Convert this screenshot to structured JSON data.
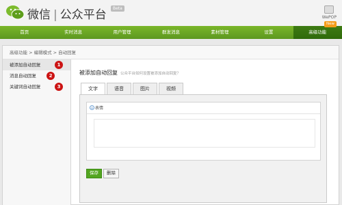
{
  "header": {
    "brand_name": "微信",
    "brand_separator": "|",
    "brand_product": "公众平台",
    "beta_label": "Beta",
    "user_name": "WePOP"
  },
  "nav": {
    "items": [
      {
        "label": "首页"
      },
      {
        "label": "实时消息"
      },
      {
        "label": "用户管理"
      },
      {
        "label": "群发消息"
      },
      {
        "label": "素材管理"
      },
      {
        "label": "设置"
      },
      {
        "label": "高级功能",
        "active": true
      }
    ],
    "new_badge": "New"
  },
  "breadcrumb": "高级功能 > 编辑模式 > 自动回复",
  "sidebar": {
    "items": [
      {
        "label": "被添加自动回复",
        "badge": "1"
      },
      {
        "label": "消息自动回复",
        "badge": "2"
      },
      {
        "label": "关键词自动回复",
        "badge": "3"
      }
    ]
  },
  "main": {
    "title": "被添加自动回复",
    "hint": "公众平台如何设置被添加自动回复？",
    "tabs": [
      {
        "label": "文字"
      },
      {
        "label": "语音"
      },
      {
        "label": "图片"
      },
      {
        "label": "视频"
      }
    ],
    "emoji_label": "表情",
    "save_label": "保存",
    "delete_label": "删除"
  },
  "colors": {
    "nav_green": "#6aa724",
    "nav_active": "#3a7510",
    "badge_red": "#cc1414",
    "new_orange": "#f59c1a",
    "save_green": "#53a521"
  }
}
